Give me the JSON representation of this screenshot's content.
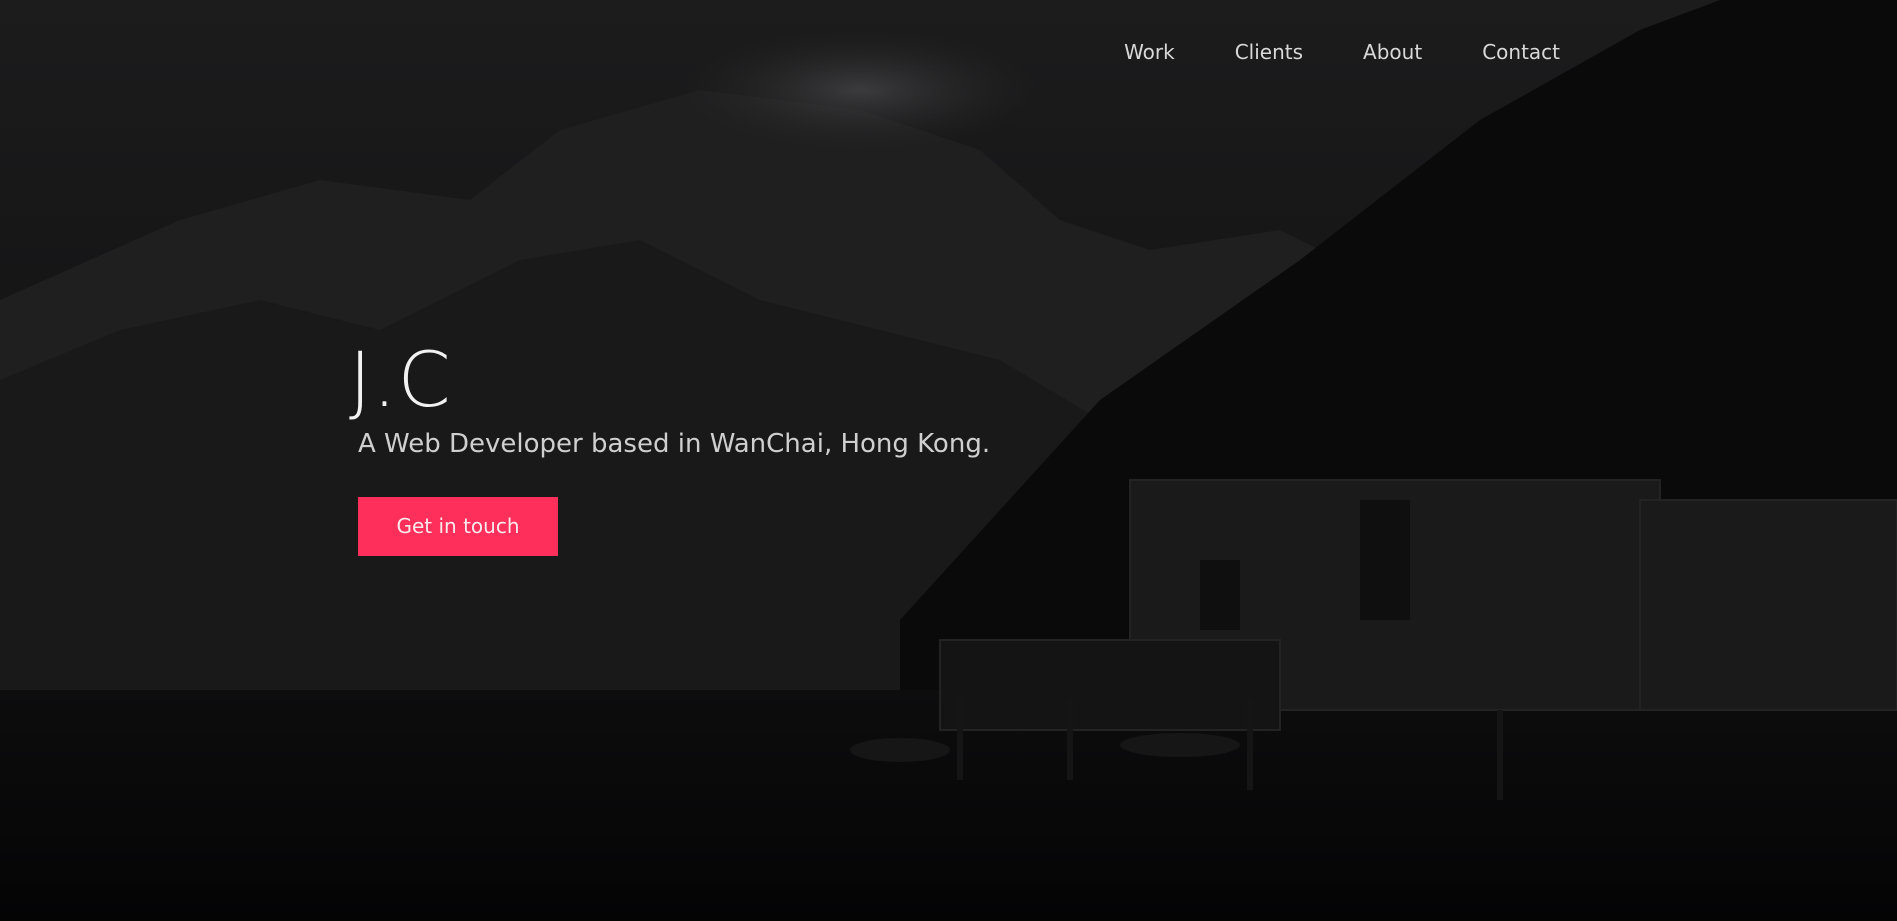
{
  "nav": {
    "items": [
      {
        "label": "Work"
      },
      {
        "label": "Clients"
      },
      {
        "label": "About"
      },
      {
        "label": "Contact"
      }
    ]
  },
  "hero": {
    "title": "J.C",
    "tagline": "A Web Developer based in WanChai, Hong Kong.",
    "cta_label": "Get in touch"
  },
  "colors": {
    "accent": "#fe2f5a",
    "background": "#0c0c0d",
    "text": "#d8d8d8"
  },
  "background_image": "dark-mountain-lake-cabin"
}
